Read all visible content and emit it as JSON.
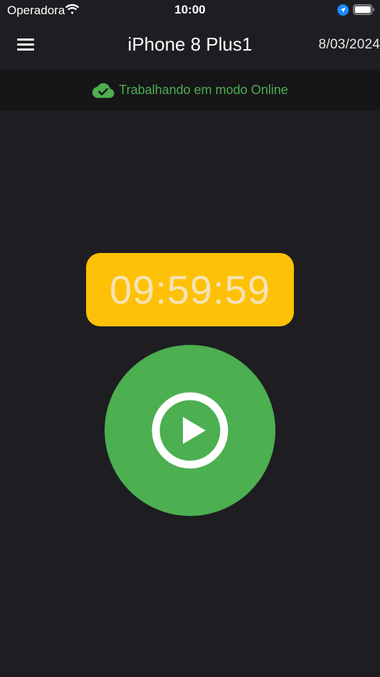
{
  "status_bar": {
    "carrier": "Operadora",
    "time": "10:00"
  },
  "nav": {
    "title": "iPhone 8 Plus1",
    "date": "8/03/2024"
  },
  "banner": {
    "text": "Trabalhando em modo Online",
    "icon": "cloud-check-icon",
    "color": "#4caf50"
  },
  "timer": {
    "value": "09:59:59",
    "background": "#ffc107"
  },
  "play_button": {
    "icon": "play-circle-icon",
    "background": "#4caf50"
  },
  "colors": {
    "background": "#1e1e22",
    "banner_background": "#161618"
  }
}
